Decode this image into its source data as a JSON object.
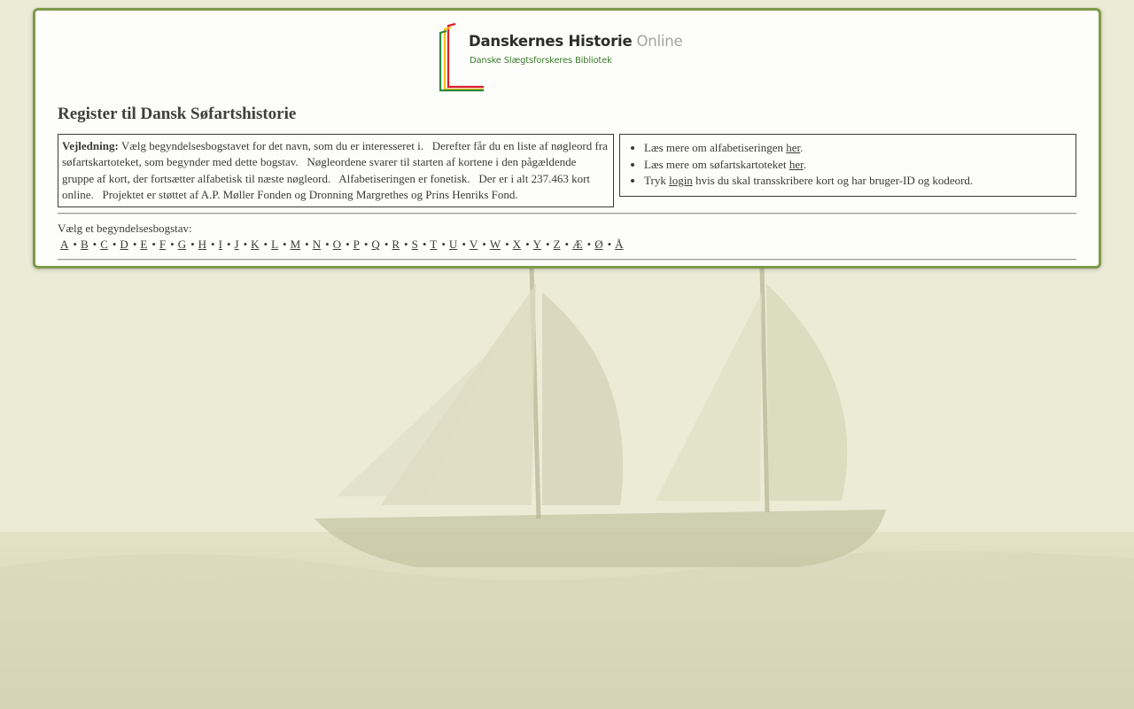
{
  "logo": {
    "title": "Danskernes Historie",
    "title_suffix": "Online",
    "subtitle": "Danske Slægtsforskeres Bibliotek"
  },
  "page": {
    "title": "Register til Dansk Søfartshistorie"
  },
  "guide": {
    "label": "Vejledning:",
    "text": "Vælg begyndelsesbogstavet for det navn, som du er interesseret i.   Derefter får du en liste af nøgleord fra søfartskartoteket, som begynder med dette bogstav.   Nøgleordene svarer til starten af kortene i den pågældende gruppe af kort, der fortsætter alfabetisk til næste nøgleord.   Alfabetiseringen er fonetisk.   Der er i alt 237.463 kort online.   Projektet er støttet af A.P. Møller Fonden og Dronning Margrethes og Prins Henriks Fond."
  },
  "info": {
    "item1_pre": "Læs mere om alfabetiseringen ",
    "item1_link": "her",
    "item1_post": ".",
    "item2_pre": "Læs mere om søfartskartoteket ",
    "item2_link": "her",
    "item2_post": ".",
    "item3_pre": "Tryk ",
    "item3_link": "login",
    "item3_post": " hvis du skal transskribere kort og har bruger-ID og kodeord."
  },
  "alphabet": {
    "label": "Vælg et begyndelsesbogstav:",
    "separator": "•",
    "letters": [
      "A",
      "B",
      "C",
      "D",
      "E",
      "F",
      "G",
      "H",
      "I",
      "J",
      "K",
      "L",
      "M",
      "N",
      "O",
      "P",
      "Q",
      "R",
      "S",
      "T",
      "U",
      "V",
      "W",
      "X",
      "Y",
      "Z",
      "Æ",
      "Ø",
      "Å"
    ]
  }
}
